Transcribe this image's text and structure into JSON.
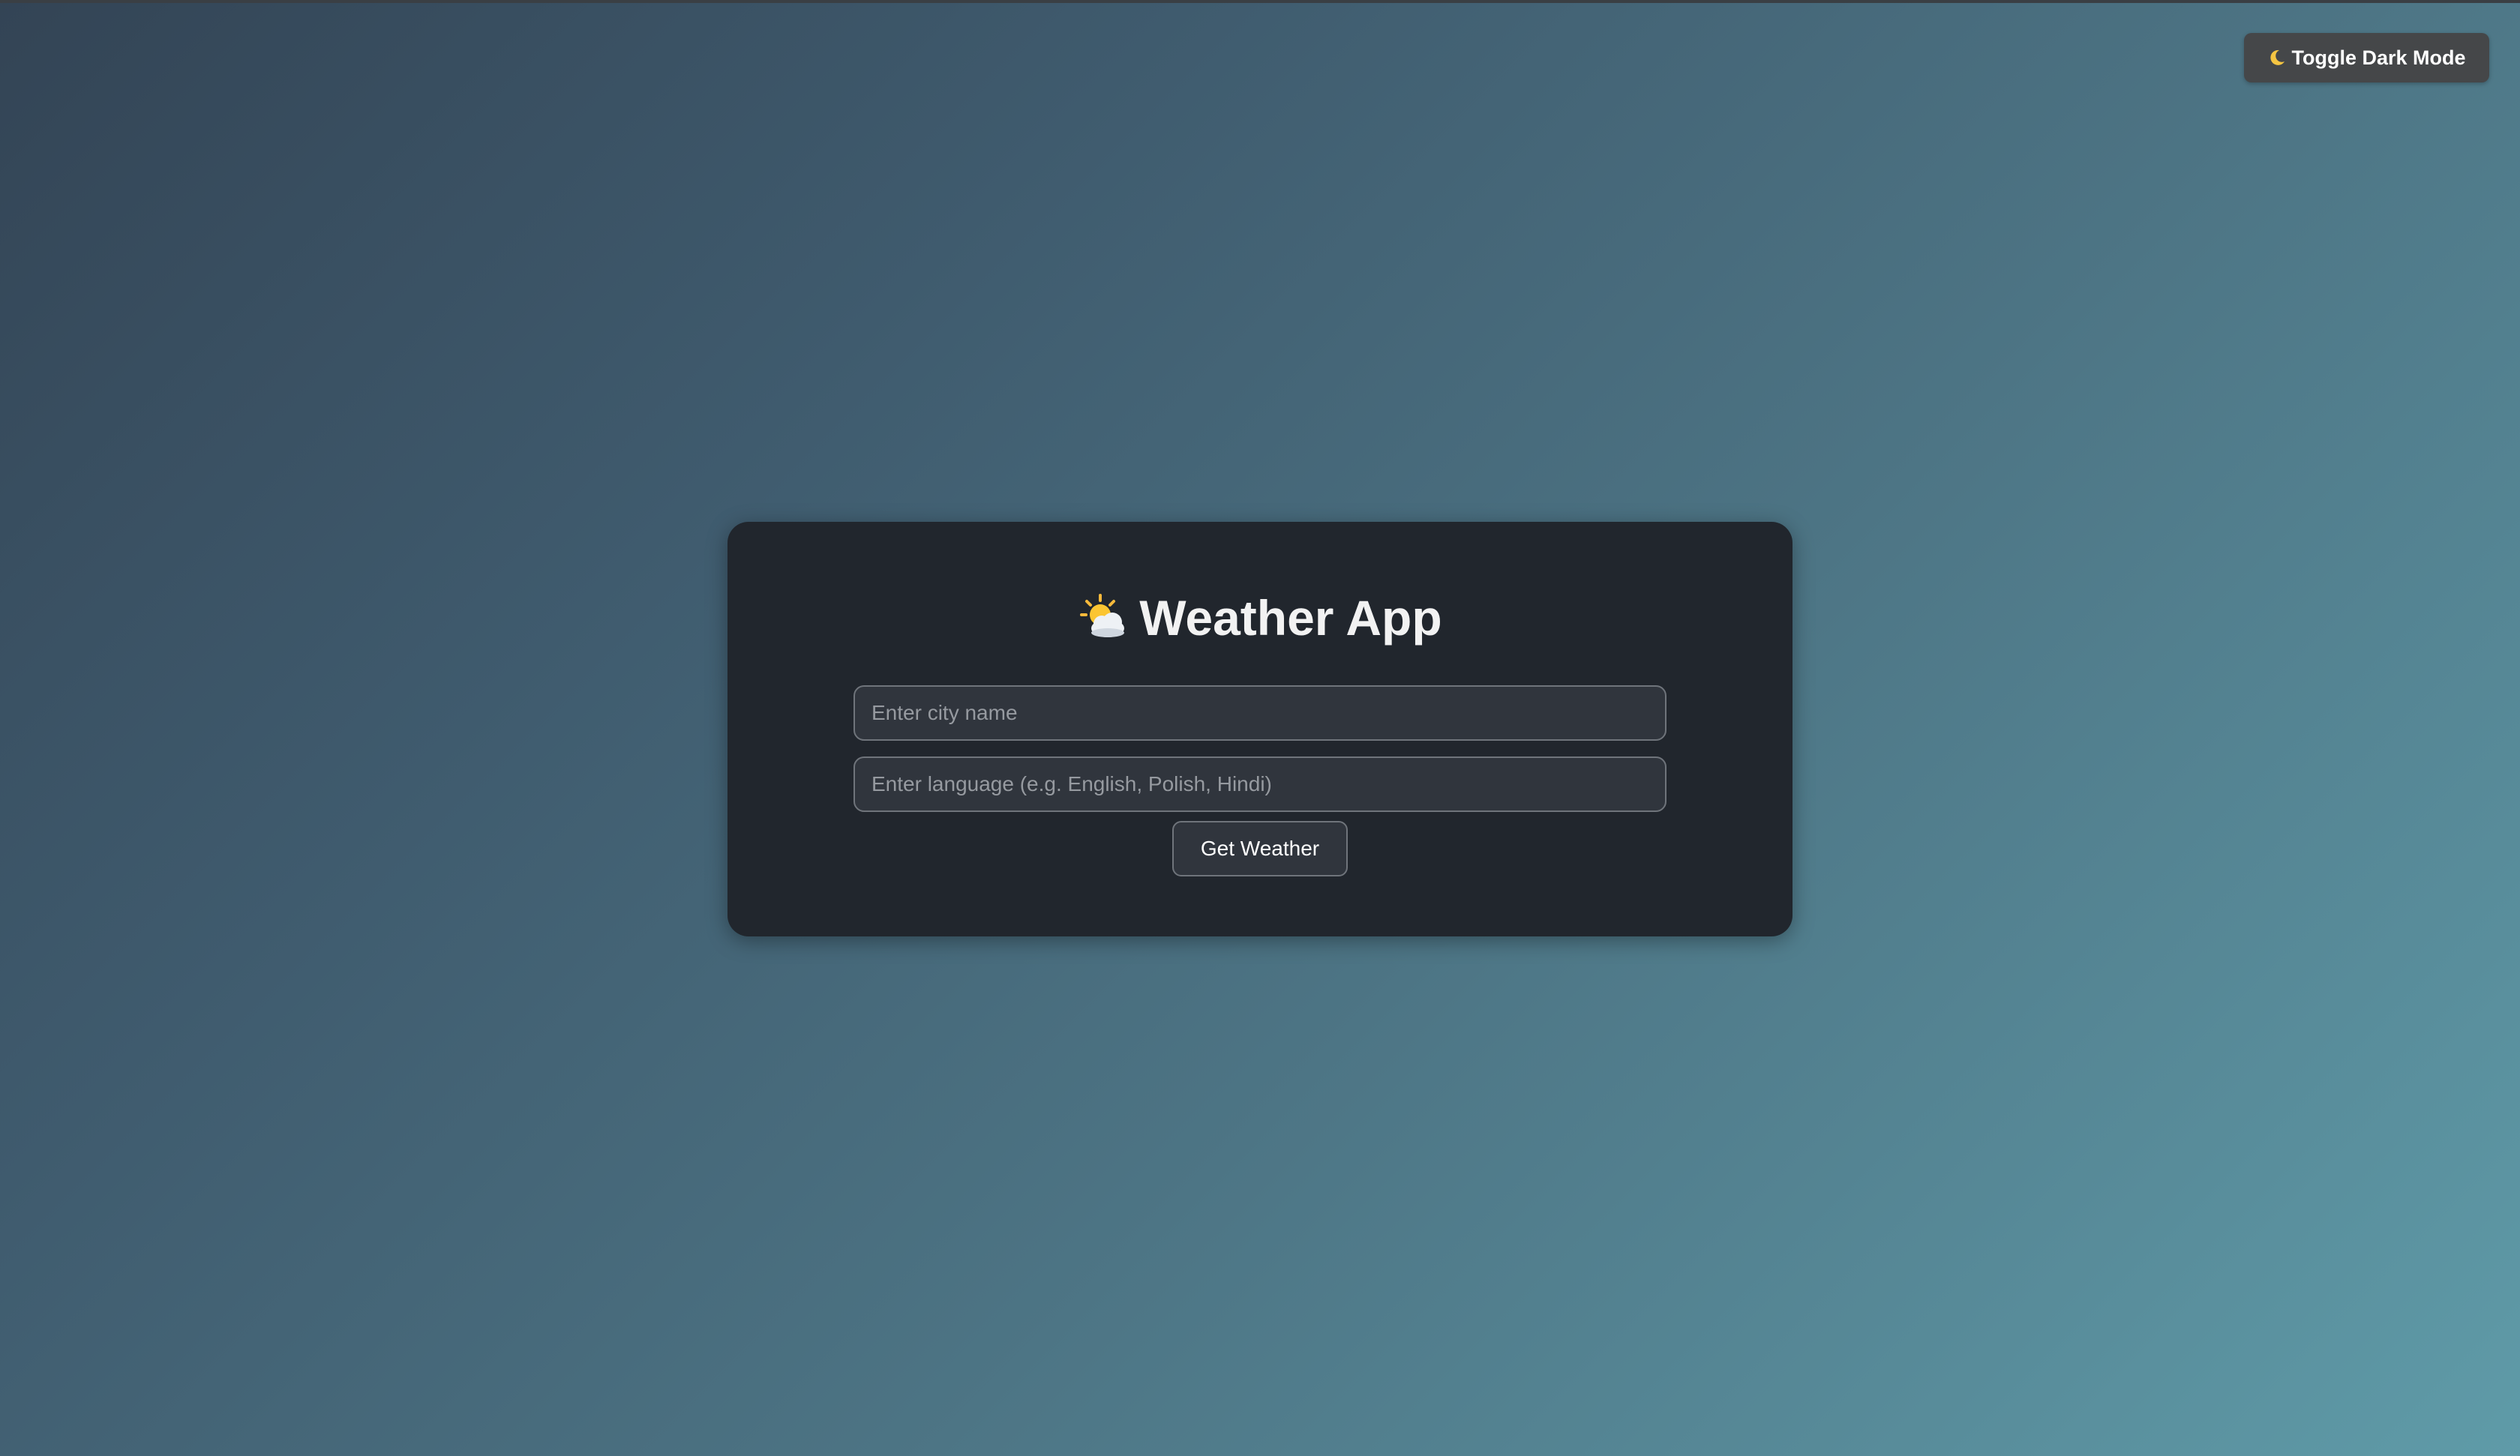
{
  "header": {
    "toggle_label": "Toggle Dark Mode",
    "toggle_icon": "moon-icon"
  },
  "card": {
    "title": "Weather App",
    "title_icon": "sun-behind-cloud-icon",
    "city_input": {
      "value": "",
      "placeholder": "Enter city name"
    },
    "language_input": {
      "value": "",
      "placeholder": "Enter language (e.g. English, Polish, Hindi)"
    },
    "submit_label": "Get Weather"
  },
  "colors": {
    "card_background": "#21262d",
    "toggle_background": "#454749",
    "input_background": "#30353d",
    "input_border": "#6f747b",
    "background_gradient_start": "#334455",
    "background_gradient_end": "#5f9ba8"
  }
}
